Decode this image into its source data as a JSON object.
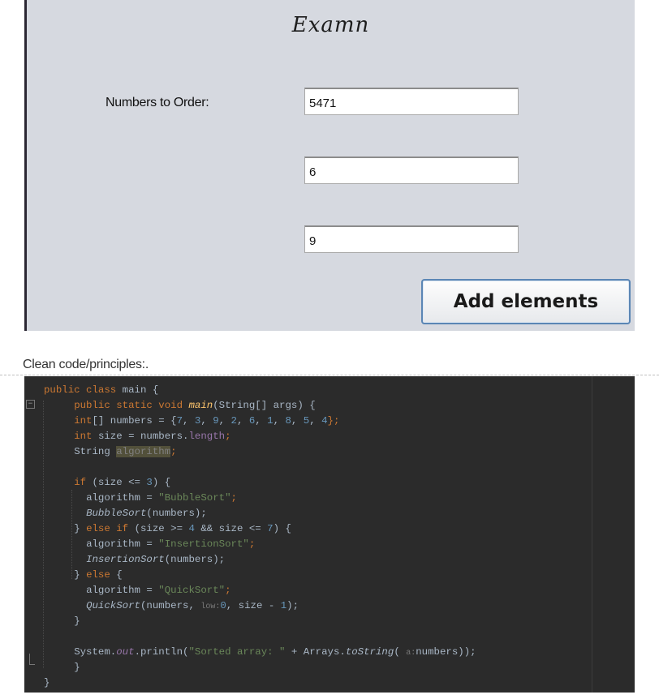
{
  "form": {
    "title": "Examn",
    "label": "Numbers to Order:",
    "inputs": [
      "5471",
      "6",
      "9"
    ],
    "button_label": "Add elements"
  },
  "caption": "Clean code/principles:.",
  "code": {
    "l1_a": "public class ",
    "l1_b": "main {",
    "l2_a": "public static void ",
    "l2_b": "main",
    "l2_c": "(String[] args) {",
    "l3_a": "int",
    "l3_b": "[] numbers = {",
    "l3_c": "7",
    "l3_d": ", ",
    "l3_e": "3",
    "l3_f": ", ",
    "l3_g": "9",
    "l3_h": ", ",
    "l3_i": "2",
    "l3_j": ", ",
    "l3_k": "6",
    "l3_l": ", ",
    "l3_m": "1",
    "l3_n": ", ",
    "l3_o": "8",
    "l3_p": ", ",
    "l3_q": "5",
    "l3_r": ", ",
    "l3_s": "4",
    "l3_t": "};",
    "l4_a": "int ",
    "l4_b": "size = numbers.",
    "l4_c": "length",
    "l4_d": ";",
    "l5_a": "String ",
    "l5_b": "algorithm",
    "l5_c": ";",
    "l6_a": "if ",
    "l6_b": "(size <= ",
    "l6_c": "3",
    "l6_d": ") {",
    "l7_a": "algorithm = ",
    "l7_b": "\"BubbleSort\"",
    "l7_c": ";",
    "l8_a": "BubbleSort",
    "l8_b": "(numbers);",
    "l9_a": "} ",
    "l9_b": "else if ",
    "l9_c": "(size >= ",
    "l9_d": "4 ",
    "l9_e": "&& size <= ",
    "l9_f": "7",
    "l9_g": ") {",
    "l10_a": "algorithm = ",
    "l10_b": "\"InsertionSort\"",
    "l10_c": ";",
    "l11_a": "InsertionSort",
    "l11_b": "(numbers);",
    "l12_a": "} ",
    "l12_b": "else ",
    "l12_c": "{",
    "l13_a": "algorithm = ",
    "l13_b": "\"QuickSort\"",
    "l13_c": ";",
    "l14_a": "QuickSort",
    "l14_b": "(numbers, ",
    "l14_c": "low:",
    "l14_d": "0",
    "l14_e": ", size - ",
    "l14_f": "1",
    "l14_g": ");",
    "l15": "}",
    "l16_a": "System.",
    "l16_b": "out",
    "l16_c": ".println(",
    "l16_d": "\"Sorted array: \" ",
    "l16_e": "+ Arrays.",
    "l16_f": "toString",
    "l16_g": "( ",
    "l16_h": "a:",
    "l16_i": "numbers));",
    "l17": "}",
    "l18": "}"
  },
  "colors": {
    "code_background": "#2b2b2b",
    "keyword": "#cc7832",
    "string": "#6a8759",
    "number": "#6897bb",
    "method": "#ffc66d",
    "form_background": "#d6d9e0",
    "button_border": "#5b86b5"
  }
}
